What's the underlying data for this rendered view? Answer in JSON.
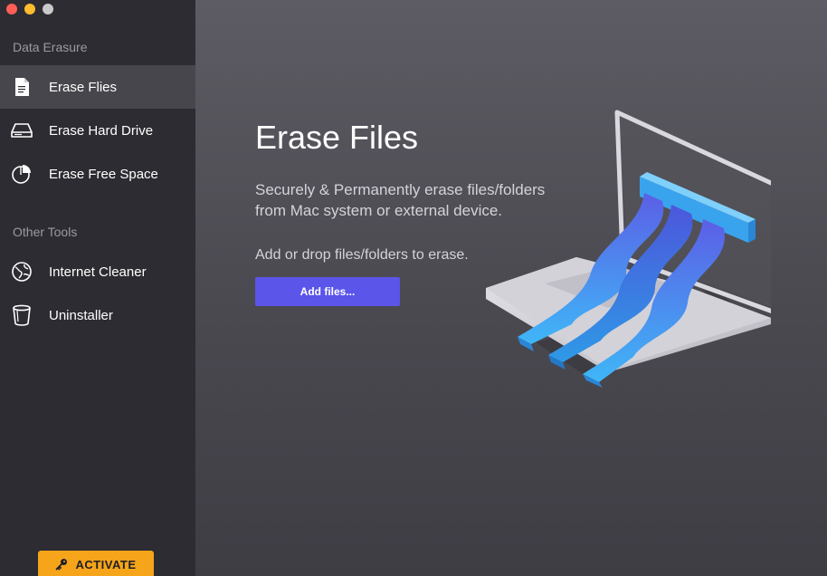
{
  "sidebar": {
    "section_data_erasure": "Data Erasure",
    "section_other_tools": "Other Tools",
    "items": [
      {
        "label": "Erase Flies",
        "icon": "document-icon"
      },
      {
        "label": "Erase Hard Drive",
        "icon": "hard-drive-icon"
      },
      {
        "label": "Erase Free Space",
        "icon": "pie-chart-icon"
      },
      {
        "label": "Internet Cleaner",
        "icon": "globe-icon"
      },
      {
        "label": "Uninstaller",
        "icon": "trash-icon"
      }
    ],
    "activate_label": "ACTIVATE"
  },
  "main": {
    "title": "Erase Files",
    "subtitle_line1": "Securely & Permanently erase files/folders",
    "subtitle_line2": "from Mac system or external device.",
    "hint": "Add or drop files/folders to erase.",
    "add_button": "Add files..."
  },
  "colors": {
    "accent": "#5b55ea",
    "activate": "#f6a41a",
    "sidebar_bg": "#2d2c32",
    "active_item_bg": "#47464c"
  }
}
